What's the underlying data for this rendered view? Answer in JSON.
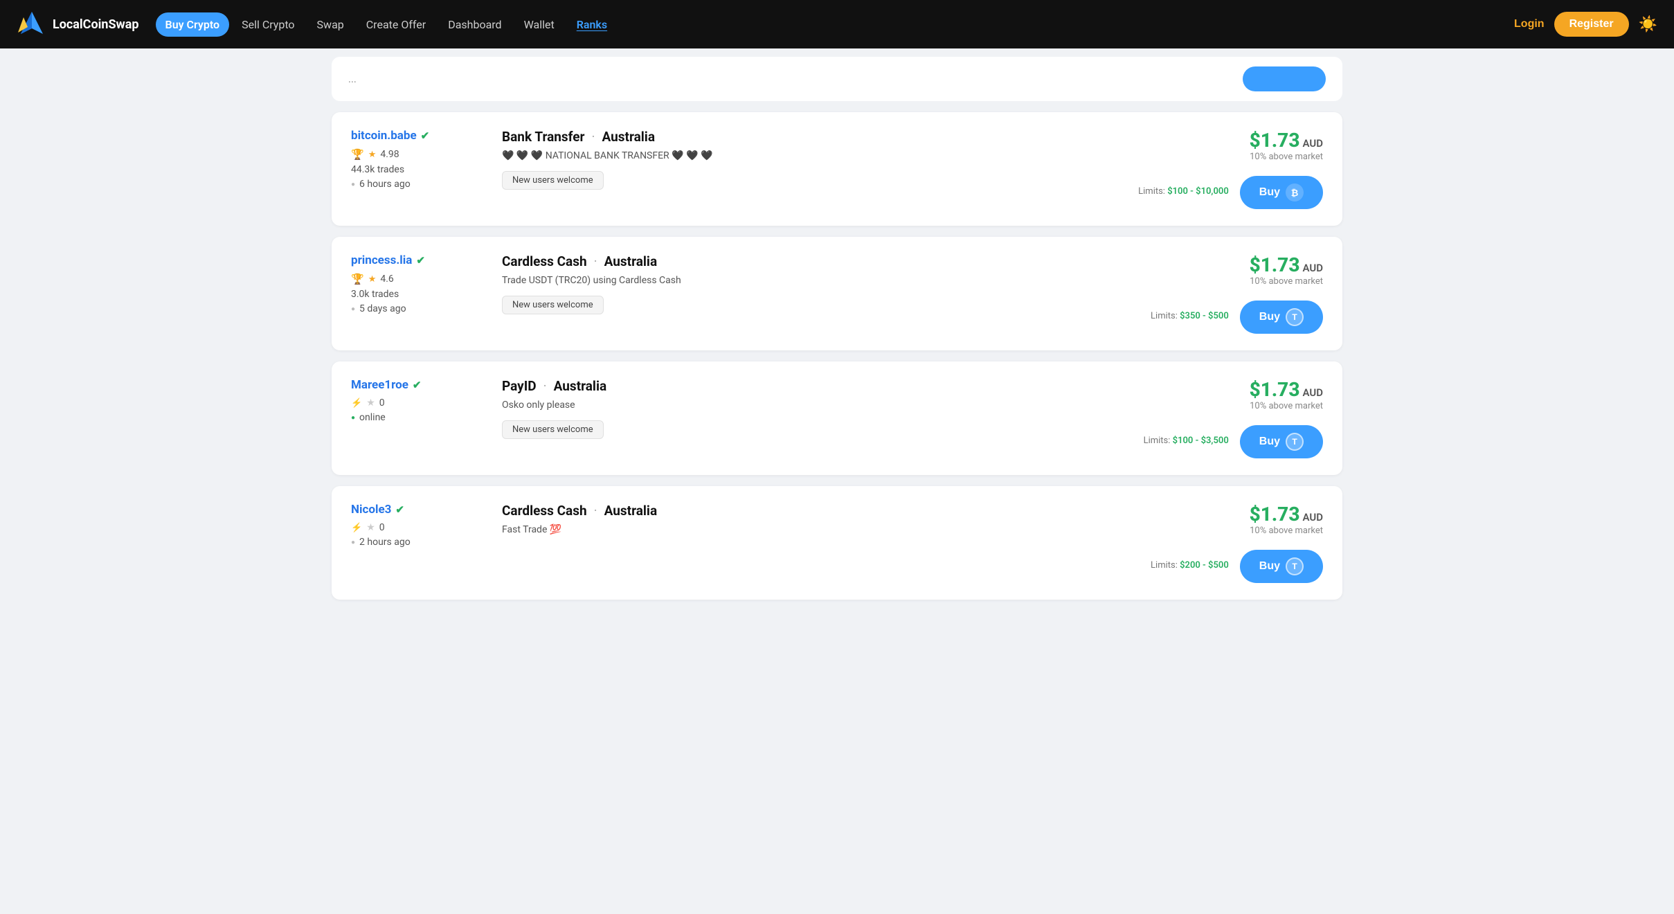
{
  "navbar": {
    "brand": "LocalCoinSwap",
    "links": [
      {
        "label": "Buy Crypto",
        "active": true,
        "name": "buy-crypto"
      },
      {
        "label": "Sell Crypto",
        "active": false,
        "name": "sell-crypto"
      },
      {
        "label": "Swap",
        "active": false,
        "name": "swap"
      },
      {
        "label": "Create Offer",
        "active": false,
        "name": "create-offer"
      },
      {
        "label": "Dashboard",
        "active": false,
        "name": "dashboard"
      },
      {
        "label": "Wallet",
        "active": false,
        "name": "wallet"
      },
      {
        "label": "Ranks",
        "active": false,
        "name": "ranks",
        "special": "ranks"
      }
    ],
    "login_label": "Login",
    "register_label": "Register",
    "theme_icon": "☀️"
  },
  "truncated": {
    "text": "..."
  },
  "offers": [
    {
      "id": "offer-1",
      "username": "bitcoin.babe",
      "verified": true,
      "badge": "trophy",
      "rating": "4.98",
      "trades": "44.3k trades",
      "last_seen": "6 hours ago",
      "last_seen_online": false,
      "method": "Bank Transfer",
      "location": "Australia",
      "description": "🖤 🖤 🖤 NATIONAL BANK TRANSFER 🖤 🖤 🖤",
      "tag": "New users welcome",
      "price": "$1.73",
      "currency": "AUD",
      "above_market": "10% above market",
      "limits_label": "Limits:",
      "limits": "$100 - $10,000",
      "buy_label": "Buy",
      "coin_type": "btc",
      "coin_symbol": "₿"
    },
    {
      "id": "offer-2",
      "username": "princess.lia",
      "verified": true,
      "badge": "trophy",
      "rating": "4.6",
      "trades": "3.0k trades",
      "last_seen": "5 days ago",
      "last_seen_online": false,
      "method": "Cardless Cash",
      "location": "Australia",
      "description": "Trade USDT (TRC20) using Cardless Cash",
      "tag": "New users welcome",
      "price": "$1.73",
      "currency": "AUD",
      "above_market": "10% above market",
      "limits_label": "Limits:",
      "limits": "$350 - $500",
      "buy_label": "Buy",
      "coin_type": "usdt",
      "coin_symbol": "T"
    },
    {
      "id": "offer-3",
      "username": "Maree1roe",
      "verified": true,
      "badge": "lightning",
      "rating": "0",
      "trades": "",
      "last_seen": "online",
      "last_seen_online": true,
      "method": "PayID",
      "location": "Australia",
      "description": "Osko only please",
      "tag": "New users welcome",
      "price": "$1.73",
      "currency": "AUD",
      "above_market": "10% above market",
      "limits_label": "Limits:",
      "limits": "$100 - $3,500",
      "buy_label": "Buy",
      "coin_type": "usdt",
      "coin_symbol": "T"
    },
    {
      "id": "offer-4",
      "username": "Nicole3",
      "verified": true,
      "badge": "lightning",
      "rating": "0",
      "trades": "",
      "last_seen": "2 hours ago",
      "last_seen_online": false,
      "method": "Cardless Cash",
      "location": "Australia",
      "description": "Fast Trade 💯",
      "tag": "",
      "price": "$1.73",
      "currency": "AUD",
      "above_market": "10% above market",
      "limits_label": "Limits:",
      "limits": "$200 - $500",
      "buy_label": "Buy",
      "coin_type": "usdt",
      "coin_symbol": "T"
    }
  ]
}
